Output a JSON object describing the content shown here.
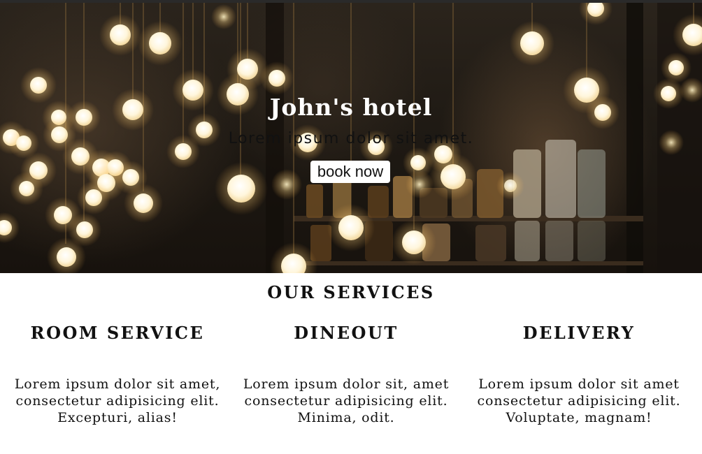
{
  "hero": {
    "title": "John's hotel",
    "subtitle": "Lorem ipsum dolor sit amet.",
    "button_label": "book now"
  },
  "services": {
    "heading": "OUR SERVICES",
    "items": [
      {
        "title": "ROOM SERVICE",
        "text": "Lorem ipsum dolor sit amet, consectetur adipisicing elit. Excepturi, alias!"
      },
      {
        "title": "DINEOUT",
        "text": "Lorem ipsum dolor sit, amet consectetur adipisicing elit. Minima, odit."
      },
      {
        "title": "DELIVERY",
        "text": "Lorem ipsum dolor sit amet consectetur adipisicing elit. Voluptate, magnam!"
      }
    ]
  },
  "colors": {
    "text": "#111111",
    "bulb": "#fff6dc",
    "hero_bg": "#1f1a14"
  }
}
